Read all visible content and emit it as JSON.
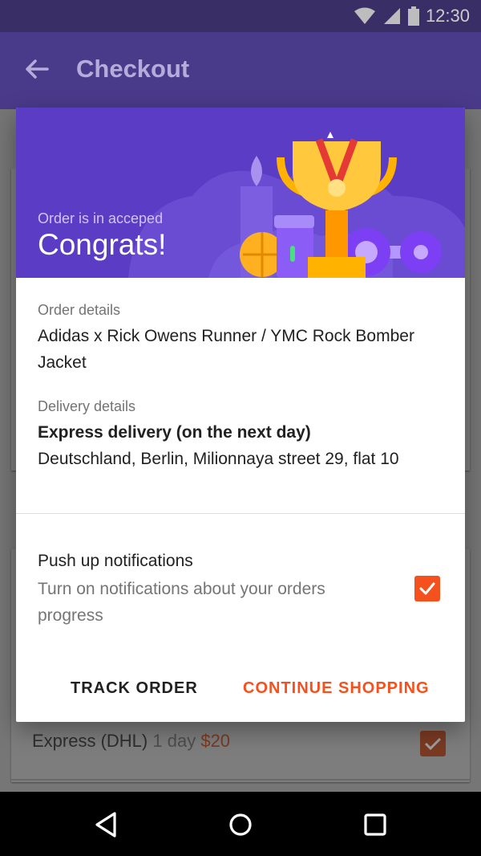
{
  "status_bar": {
    "time": "12:30",
    "icons": [
      "wifi-icon",
      "signal-icon",
      "battery-icon"
    ]
  },
  "app_bar": {
    "title": "Checkout",
    "back_icon": "arrow-back-icon"
  },
  "background_screen": {
    "shipping_option": {
      "name": "Express (DHL)",
      "duration": "1 day",
      "price": "$20",
      "checked": true
    }
  },
  "dialog": {
    "hero": {
      "subtitle": "Order is in acceped",
      "title": "Congrats!",
      "illustration": "trophy-sports-illustration"
    },
    "order": {
      "label": "Order details",
      "text": "Adidas x Rick Owens Runner / YMC Rock Bomber Jacket"
    },
    "delivery": {
      "label": "Delivery details",
      "method": "Express delivery (on the next day)",
      "address": "Deutschland, Berlin, Milionnaya street 29, flat 10"
    },
    "notifications": {
      "title": "Push up notifications",
      "description": "Turn on notifications about your orders progress",
      "checked": true
    },
    "actions": {
      "track_label": "TRACK ORDER",
      "continue_label": "CONTINUE SHOPPING"
    }
  },
  "nav_bar": {
    "icons": [
      "back-triangle-icon",
      "home-circle-icon",
      "recents-square-icon"
    ]
  },
  "colors": {
    "primary": "#5b3cc4",
    "accent": "#f4511e",
    "app_bar_dimmed": "#4a3a8a",
    "status_bar_dimmed": "#392e66"
  }
}
